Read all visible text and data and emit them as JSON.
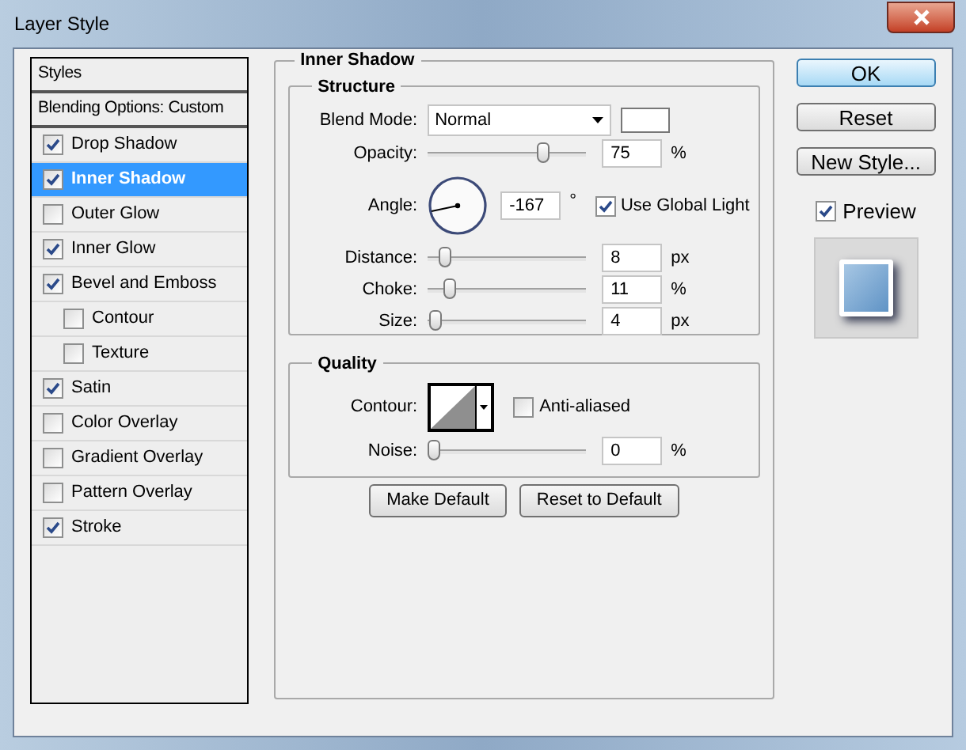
{
  "window": {
    "title": "Layer Style"
  },
  "styles_list": [
    {
      "kind": "header",
      "label": "Styles",
      "selected": false
    },
    {
      "kind": "header",
      "label": "Blending Options: Custom",
      "selected": false
    },
    {
      "kind": "check",
      "label": "Drop Shadow",
      "checked": true,
      "selected": false
    },
    {
      "kind": "check",
      "label": "Inner Shadow",
      "checked": true,
      "selected": true
    },
    {
      "kind": "check",
      "label": "Outer Glow",
      "checked": false,
      "selected": false
    },
    {
      "kind": "check",
      "label": "Inner Glow",
      "checked": true,
      "selected": false
    },
    {
      "kind": "check",
      "label": "Bevel and Emboss",
      "checked": true,
      "selected": false,
      "children": [
        {
          "kind": "check",
          "label": "Contour",
          "checked": false,
          "selected": false
        },
        {
          "kind": "check",
          "label": "Texture",
          "checked": false,
          "selected": false
        }
      ]
    },
    {
      "kind": "check",
      "label": "Satin",
      "checked": true,
      "selected": false
    },
    {
      "kind": "check",
      "label": "Color Overlay",
      "checked": false,
      "selected": false
    },
    {
      "kind": "check",
      "label": "Gradient Overlay",
      "checked": false,
      "selected": false
    },
    {
      "kind": "check",
      "label": "Pattern Overlay",
      "checked": false,
      "selected": false
    },
    {
      "kind": "check",
      "label": "Stroke",
      "checked": true,
      "selected": false
    }
  ],
  "panel": {
    "title": "Inner Shadow",
    "structure": {
      "title": "Structure",
      "blend_mode": {
        "label": "Blend Mode:",
        "value": "Normal"
      },
      "rows": [
        {
          "kind": "slider",
          "label": "Opacity:",
          "level": 0.75,
          "value": "75",
          "unit": "%"
        },
        {
          "kind": "angle",
          "label": "Angle:",
          "value": "-167",
          "unit": "°",
          "global_light": {
            "label": "Use Global Light",
            "checked": true
          }
        },
        {
          "kind": "slider",
          "label": "Distance:",
          "level": 0.08,
          "value": "8",
          "unit": "px"
        },
        {
          "kind": "slider",
          "label": "Choke:",
          "level": 0.11,
          "value": "11",
          "unit": "%"
        },
        {
          "kind": "slider",
          "label": "Size:",
          "level": 0.02,
          "value": "4",
          "unit": "px"
        }
      ]
    },
    "quality": {
      "title": "Quality",
      "contour_label": "Contour:",
      "anti_aliased": {
        "label": "Anti-aliased",
        "checked": false
      },
      "noise": {
        "label": "Noise:",
        "level": 0,
        "value": "0",
        "unit": "%"
      }
    },
    "buttons": [
      "Make Default",
      "Reset to Default"
    ]
  },
  "actions": [
    {
      "label": "OK",
      "selected": true
    },
    {
      "label": "Reset",
      "selected": false
    },
    {
      "label": "New Style...",
      "selected": false
    }
  ],
  "preview": {
    "label": "Preview",
    "checked": true
  }
}
